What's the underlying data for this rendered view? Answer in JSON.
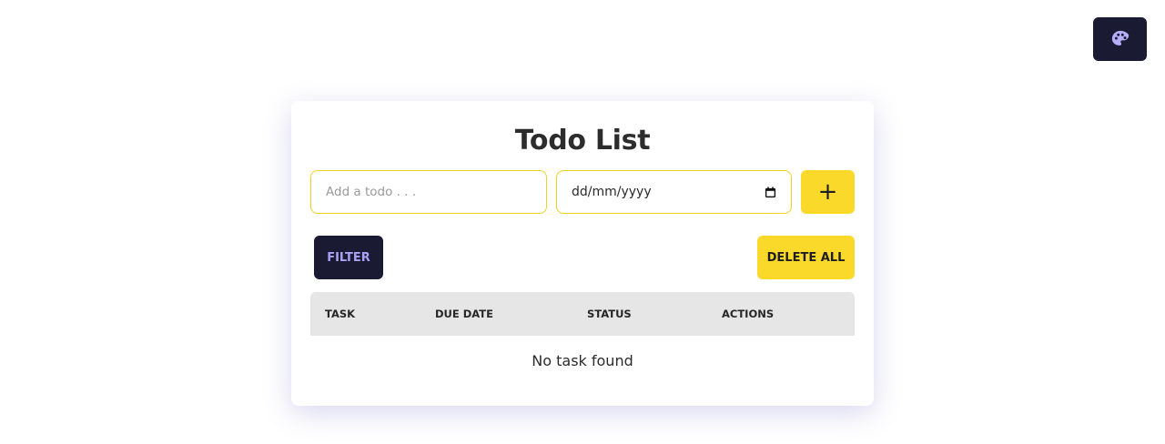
{
  "theme_toggle": {
    "icon": "palette-icon",
    "color": "#1b1a33"
  },
  "app": {
    "title": "Todo List",
    "todo_input": {
      "placeholder": "Add a todo . . .",
      "value": ""
    },
    "date_input": {
      "placeholder": "dd/mm/yyyy",
      "icon": "calendar-icon"
    },
    "add_button": {
      "label": "+"
    },
    "filter_button": {
      "label": "FILTER"
    },
    "delete_all_button": {
      "label": "DELETE ALL"
    },
    "table": {
      "columns": [
        "TASK",
        "DUE DATE",
        "STATUS",
        "ACTIONS"
      ],
      "rows": [],
      "empty_message": "No task found"
    }
  },
  "colors": {
    "accent_yellow": "#fad92b",
    "dark": "#1b1a33",
    "filter_text": "#a9a2f5",
    "header_bg": "#e6e6e6"
  }
}
